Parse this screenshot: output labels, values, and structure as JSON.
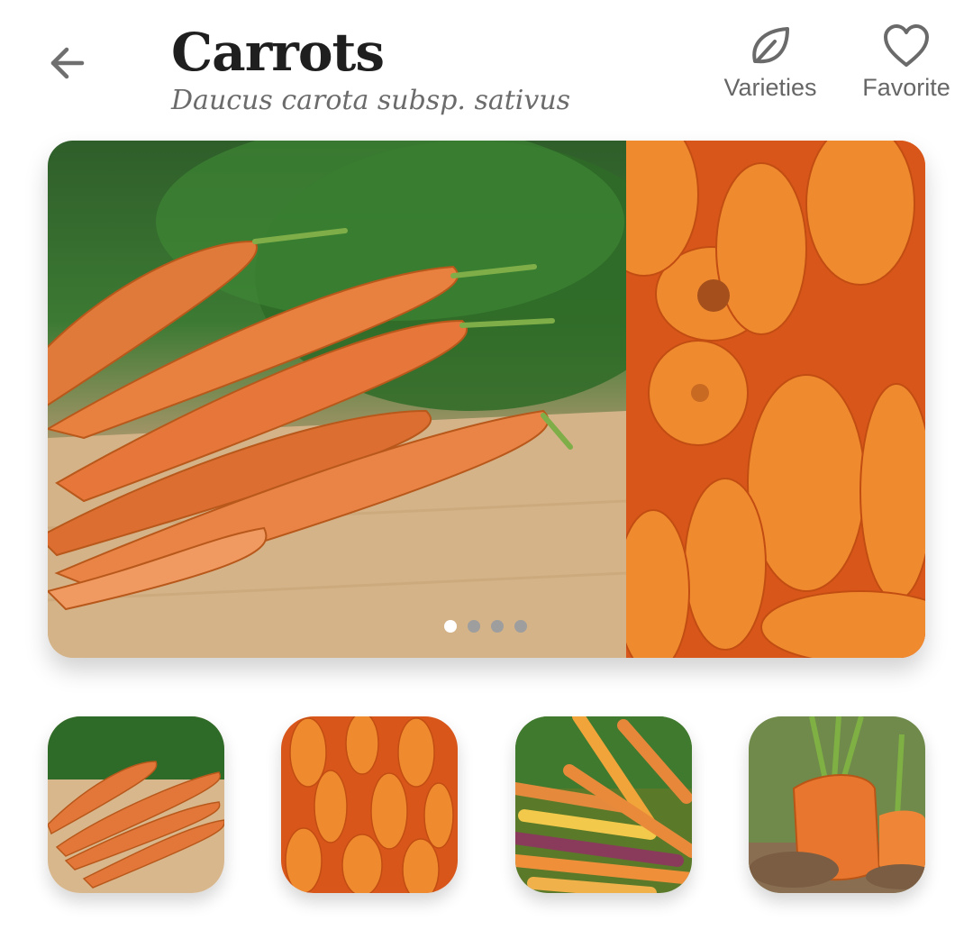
{
  "header": {
    "title": "Carrots",
    "subtitle": "Daucus carota subsp. sativus",
    "actions": {
      "varieties_label": "Varieties",
      "favorite_label": "Favorite"
    }
  },
  "carousel": {
    "page_count": 4,
    "active_index": 0
  },
  "colors": {
    "title": "#1f1f1f",
    "subtitle": "#6b6b6b",
    "icon": "#666666",
    "carrot_orange": "#e8641a",
    "dot_active": "#ffffff",
    "dot_inactive": "#9e9e9e"
  },
  "icons": {
    "back": "arrow-left-icon",
    "varieties": "leaf-icon",
    "favorite": "heart-outline-icon"
  }
}
